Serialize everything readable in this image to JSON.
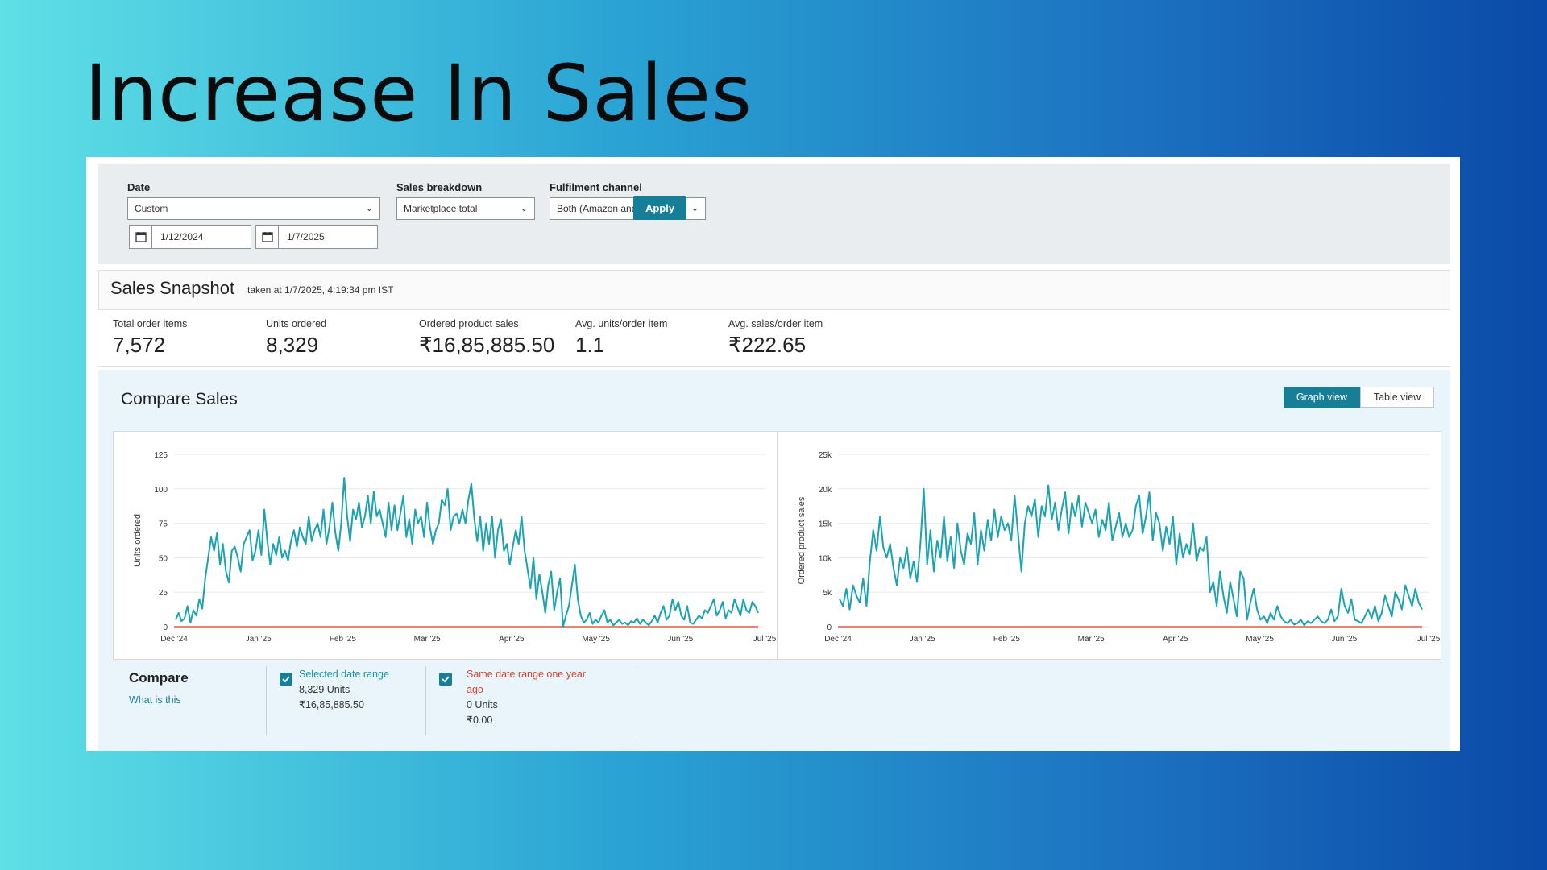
{
  "slide": {
    "title": "Increase In Sales"
  },
  "filters": {
    "date_label": "Date",
    "date_select": "Custom",
    "start_date": "1/12/2024",
    "end_date": "1/7/2025",
    "breakdown_label": "Sales breakdown",
    "breakdown_select": "Marketplace total",
    "channel_label": "Fulfilment channel",
    "channel_select": "Both (Amazon and seller)",
    "apply_label": "Apply"
  },
  "snapshot": {
    "title": "Sales Snapshot",
    "subtitle": "taken at 1/7/2025, 4:19:34 pm IST",
    "metrics": [
      {
        "label": "Total order items",
        "value": "7,572"
      },
      {
        "label": "Units ordered",
        "value": "8,329"
      },
      {
        "label": "Ordered product sales",
        "value": "₹16,85,885.50"
      },
      {
        "label": "Avg. units/order item",
        "value": "1.1"
      },
      {
        "label": "Avg. sales/order item",
        "value": "₹222.65"
      }
    ]
  },
  "compare": {
    "title": "Compare Sales",
    "graph_view": "Graph view",
    "table_view": "Table view",
    "legend_title": "Compare",
    "legend_link": "What is this",
    "selected": {
      "header": "Selected date range",
      "units": "8,329 Units",
      "sales": "₹16,85,885.50"
    },
    "previous": {
      "header_line1": "Same date range one year",
      "header_line2": "ago",
      "units": "0 Units",
      "sales": "₹0.00"
    }
  },
  "colors": {
    "accent": "#167e96",
    "series_current": "#1aa3b0",
    "series_previous": "#e8837a"
  },
  "chart_data": [
    {
      "type": "line",
      "ylabel": "Units ordered",
      "ylim": [
        0,
        125
      ],
      "yticks": [
        "0",
        "25",
        "50",
        "75",
        "100",
        "125"
      ],
      "xticks": [
        "Dec '24",
        "Jan '25",
        "Feb '25",
        "Mar '25",
        "Apr '25",
        "May '25",
        "Jun '25",
        "Jul '25"
      ],
      "grid": true,
      "series": [
        {
          "values": [
            5,
            10,
            4,
            6,
            15,
            3,
            12,
            8,
            20,
            13,
            35,
            50,
            65,
            55,
            68,
            45,
            60,
            40,
            32,
            55,
            58,
            50,
            40,
            60,
            65,
            70,
            48,
            55,
            70,
            52,
            85,
            62,
            45,
            60,
            52,
            65,
            50,
            55,
            48,
            62,
            70,
            58,
            72,
            65,
            60,
            80,
            62,
            70,
            75,
            65,
            85,
            60,
            72,
            90,
            68,
            55,
            75,
            108,
            80,
            62,
            85,
            78,
            90,
            72,
            80,
            95,
            75,
            98,
            80,
            85,
            75,
            65,
            90,
            70,
            88,
            70,
            82,
            95,
            65,
            78,
            60,
            85,
            75,
            80,
            65,
            90,
            72,
            60,
            70,
            75,
            92,
            88,
            100,
            70,
            80,
            82,
            75,
            85,
            75,
            92,
            104,
            78,
            62,
            80,
            55,
            75,
            60,
            80,
            50,
            70,
            78,
            55,
            60,
            45,
            58,
            70,
            60,
            80,
            55,
            42,
            28,
            50,
            20,
            38,
            25,
            10,
            30,
            40,
            12,
            25,
            35,
            0,
            8,
            15,
            30,
            45,
            20,
            8,
            3,
            5,
            10,
            2,
            5,
            3,
            8,
            12,
            3,
            5,
            1,
            3,
            5,
            2,
            3,
            1,
            4,
            3,
            6,
            2,
            5,
            3,
            1,
            4,
            8,
            3,
            10,
            15,
            5,
            8,
            20,
            12,
            18,
            8,
            5,
            15,
            3,
            2,
            5,
            8,
            6,
            12,
            10,
            15,
            20,
            8,
            12,
            18,
            6,
            12,
            10,
            20,
            14,
            8,
            20,
            12,
            10,
            18,
            15,
            10
          ],
          "color": "#1aa3b0"
        },
        {
          "values": [
            0,
            0
          ],
          "color": "#e8837a"
        }
      ]
    },
    {
      "type": "line",
      "ylabel": "Ordered product sales",
      "ylim": [
        0,
        25000
      ],
      "yticks": [
        "0",
        "5k",
        "10k",
        "15k",
        "20k",
        "25k"
      ],
      "xticks": [
        "Dec '24",
        "Jan '25",
        "Feb '25",
        "Mar '25",
        "Apr '25",
        "May '25",
        "Jun '25",
        "Jul '25"
      ],
      "grid": true,
      "series": [
        {
          "values": [
            4000,
            3000,
            5500,
            2500,
            6000,
            4500,
            3500,
            7000,
            3000,
            9500,
            14000,
            11000,
            16000,
            11500,
            10000,
            12000,
            8500,
            6000,
            10000,
            8500,
            11500,
            7000,
            9500,
            6500,
            12000,
            20000,
            9000,
            14000,
            8000,
            12500,
            10000,
            16000,
            9500,
            13000,
            8500,
            15000,
            11000,
            9000,
            13500,
            12000,
            16500,
            9000,
            14000,
            11000,
            15500,
            12500,
            17000,
            13000,
            16000,
            14000,
            15000,
            12500,
            19000,
            13500,
            8000,
            15000,
            17500,
            16000,
            18500,
            13000,
            17500,
            16000,
            20500,
            15500,
            18000,
            14000,
            17000,
            19500,
            13500,
            18000,
            16000,
            19000,
            14500,
            18000,
            16500,
            15000,
            17000,
            13000,
            15500,
            14000,
            18000,
            12500,
            14500,
            16500,
            13000,
            15000,
            13000,
            14000,
            17500,
            19000,
            13500,
            16000,
            19500,
            12500,
            16500,
            15000,
            11000,
            14500,
            12000,
            16000,
            9000,
            13500,
            10000,
            12000,
            10500,
            15000,
            9500,
            11500,
            11000,
            13000,
            5000,
            6500,
            3000,
            8000,
            4500,
            2000,
            6500,
            4000,
            1500,
            8000,
            7000,
            1000,
            3500,
            5500,
            2500,
            1000,
            1500,
            500,
            2000,
            1000,
            3000,
            1500,
            800,
            500,
            1000,
            300,
            500,
            1000,
            200,
            800,
            500,
            1000,
            1500,
            800,
            500,
            1000,
            2500,
            800,
            1500,
            5500,
            3000,
            2000,
            4000,
            1000,
            800,
            500,
            1500,
            2500,
            1200,
            3000,
            800,
            2000,
            4500,
            3000,
            1500,
            5000,
            4000,
            2500,
            6000,
            4500,
            3000,
            5500,
            3500,
            2500
          ],
          "color": "#1aa3b0"
        },
        {
          "values": [
            0,
            0
          ],
          "color": "#e8837a"
        }
      ]
    }
  ]
}
